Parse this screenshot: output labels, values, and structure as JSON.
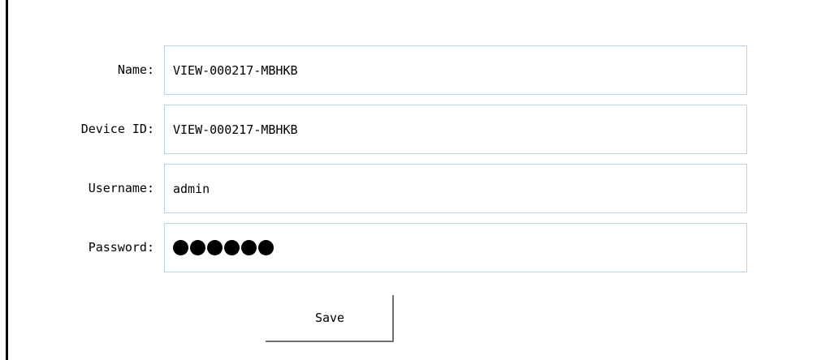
{
  "form": {
    "name": {
      "label": "Name:",
      "value": "VIEW-000217-MBHKB"
    },
    "device_id": {
      "label": "Device ID:",
      "value": "VIEW-000217-MBHKB"
    },
    "username": {
      "label": "Username:",
      "value": "admin"
    },
    "password": {
      "label": "Password:",
      "masked_length": 6
    }
  },
  "save_label": "Save"
}
